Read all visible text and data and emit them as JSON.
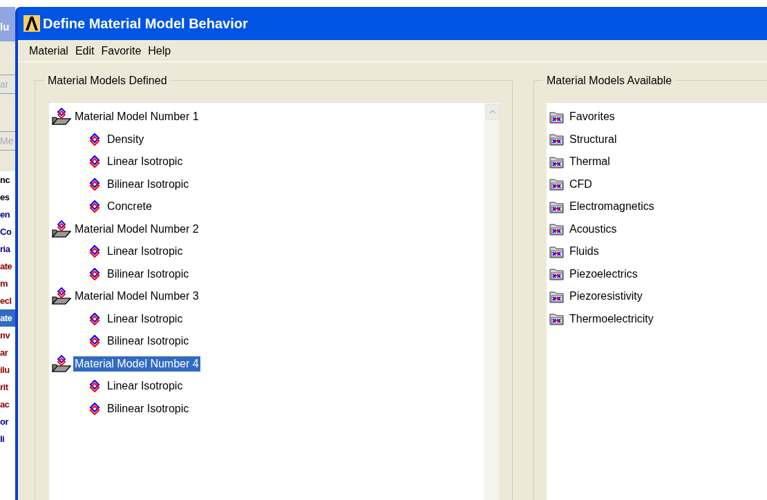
{
  "background_window": {
    "title": "lu",
    "buttons": [
      "ar",
      "Me"
    ],
    "list": [
      {
        "text": "nc",
        "color": "#000000",
        "selected": false
      },
      {
        "text": "es",
        "color": "#000000",
        "selected": false
      },
      {
        "text": "en",
        "color": "#00008b",
        "selected": false
      },
      {
        "text": "Co",
        "color": "#00008b",
        "selected": false
      },
      {
        "text": "ria",
        "color": "#00008b",
        "selected": false
      },
      {
        "text": "ate",
        "color": "#8b0000",
        "selected": false
      },
      {
        "text": "m",
        "color": "#8b0000",
        "selected": false
      },
      {
        "text": "ecl",
        "color": "#8b0000",
        "selected": false
      },
      {
        "text": "ate",
        "selected": true
      },
      {
        "text": "nv",
        "color": "#8b0000",
        "selected": false
      },
      {
        "text": "ar",
        "color": "#8b0000",
        "selected": false
      },
      {
        "text": "ilu",
        "color": "#8b0000",
        "selected": false
      },
      {
        "text": "rit",
        "color": "#8b0000",
        "selected": false
      },
      {
        "text": "ac",
        "color": "#8b0000",
        "selected": false
      },
      {
        "text": "or",
        "color": "#00008b",
        "selected": false
      },
      {
        "text": "li",
        "color": "#00008b",
        "selected": false
      }
    ]
  },
  "window": {
    "title": "Define Material Model Behavior"
  },
  "menu": [
    "Material",
    "Edit",
    "Favorite",
    "Help"
  ],
  "defined": {
    "title": "Material Models Defined",
    "tree": [
      {
        "label": "Material Model Number 1",
        "selected": false,
        "children": [
          {
            "label": "Density",
            "selected": false
          },
          {
            "label": "Linear Isotropic",
            "selected": false
          },
          {
            "label": "Bilinear Isotropic",
            "selected": false
          },
          {
            "label": "Concrete",
            "selected": false
          }
        ]
      },
      {
        "label": "Material Model Number 2",
        "selected": false,
        "children": [
          {
            "label": "Linear Isotropic",
            "selected": false
          },
          {
            "label": "Bilinear Isotropic",
            "selected": false
          }
        ]
      },
      {
        "label": "Material Model Number 3",
        "selected": false,
        "children": [
          {
            "label": "Linear Isotropic",
            "selected": false
          },
          {
            "label": "Bilinear Isotropic",
            "selected": false
          }
        ]
      },
      {
        "label": "Material Model Number 4",
        "selected": true,
        "children": [
          {
            "label": "Linear Isotropic",
            "selected": false
          },
          {
            "label": "Bilinear Isotropic",
            "selected": false
          }
        ]
      }
    ]
  },
  "available": {
    "title": "Material Models Available",
    "items": [
      {
        "label": "Favorites",
        "selected": false
      },
      {
        "label": "Structural",
        "selected": false
      },
      {
        "label": "Thermal",
        "selected": false
      },
      {
        "label": "CFD",
        "selected": false
      },
      {
        "label": "Electromagnetics",
        "selected": false
      },
      {
        "label": "Acoustics",
        "selected": false
      },
      {
        "label": "Fluids",
        "selected": false
      },
      {
        "label": "Piezoelectrics",
        "selected": false
      },
      {
        "label": "Piezoresistivity",
        "selected": false
      },
      {
        "label": "Thermoelectricity",
        "selected": false
      }
    ]
  }
}
